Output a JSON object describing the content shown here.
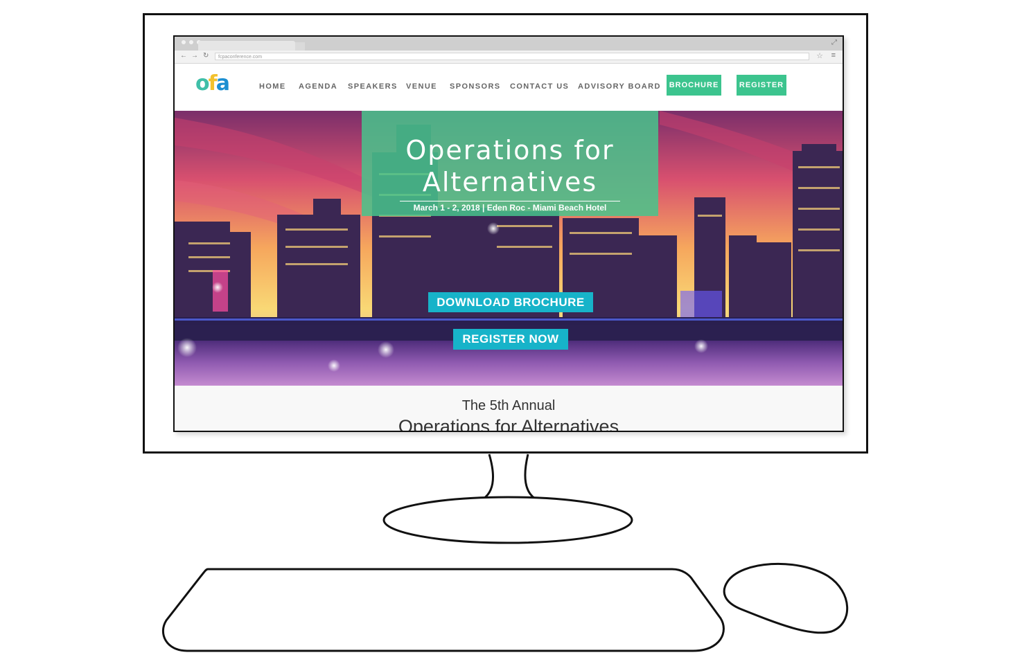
{
  "browser": {
    "url": "fcpaconference.com",
    "back_icon": "back-arrow-icon",
    "forward_icon": "forward-arrow-icon"
  },
  "site": {
    "logo_text": {
      "o": "o",
      "f": "f",
      "a": "a"
    },
    "nav": [
      "HOME",
      "AGENDA",
      "SPEAKERS",
      "VENUE",
      "SPONSORS",
      "CONTACT US",
      "ADVISORY BOARD"
    ],
    "brochure_label": "BROCHURE",
    "register_label": "REGISTER"
  },
  "hero": {
    "title_line1": "Operations for",
    "title_line2": "Alternatives",
    "subtitle": "March 1 - 2, 2018 | Eden Roc - Miami Beach Hotel",
    "download_label": "DOWNLOAD BROCHURE",
    "register_now_label": "REGISTER NOW"
  },
  "intro": {
    "line1": "The 5th Annual",
    "line2": "Operations for Alternatives"
  },
  "colors": {
    "accent_green": "#3cc48e",
    "button_teal": "#17b3c9",
    "logo_teal": "#3fbfa8",
    "logo_yellow": "#f2c12e",
    "logo_blue": "#1b8ed1"
  }
}
